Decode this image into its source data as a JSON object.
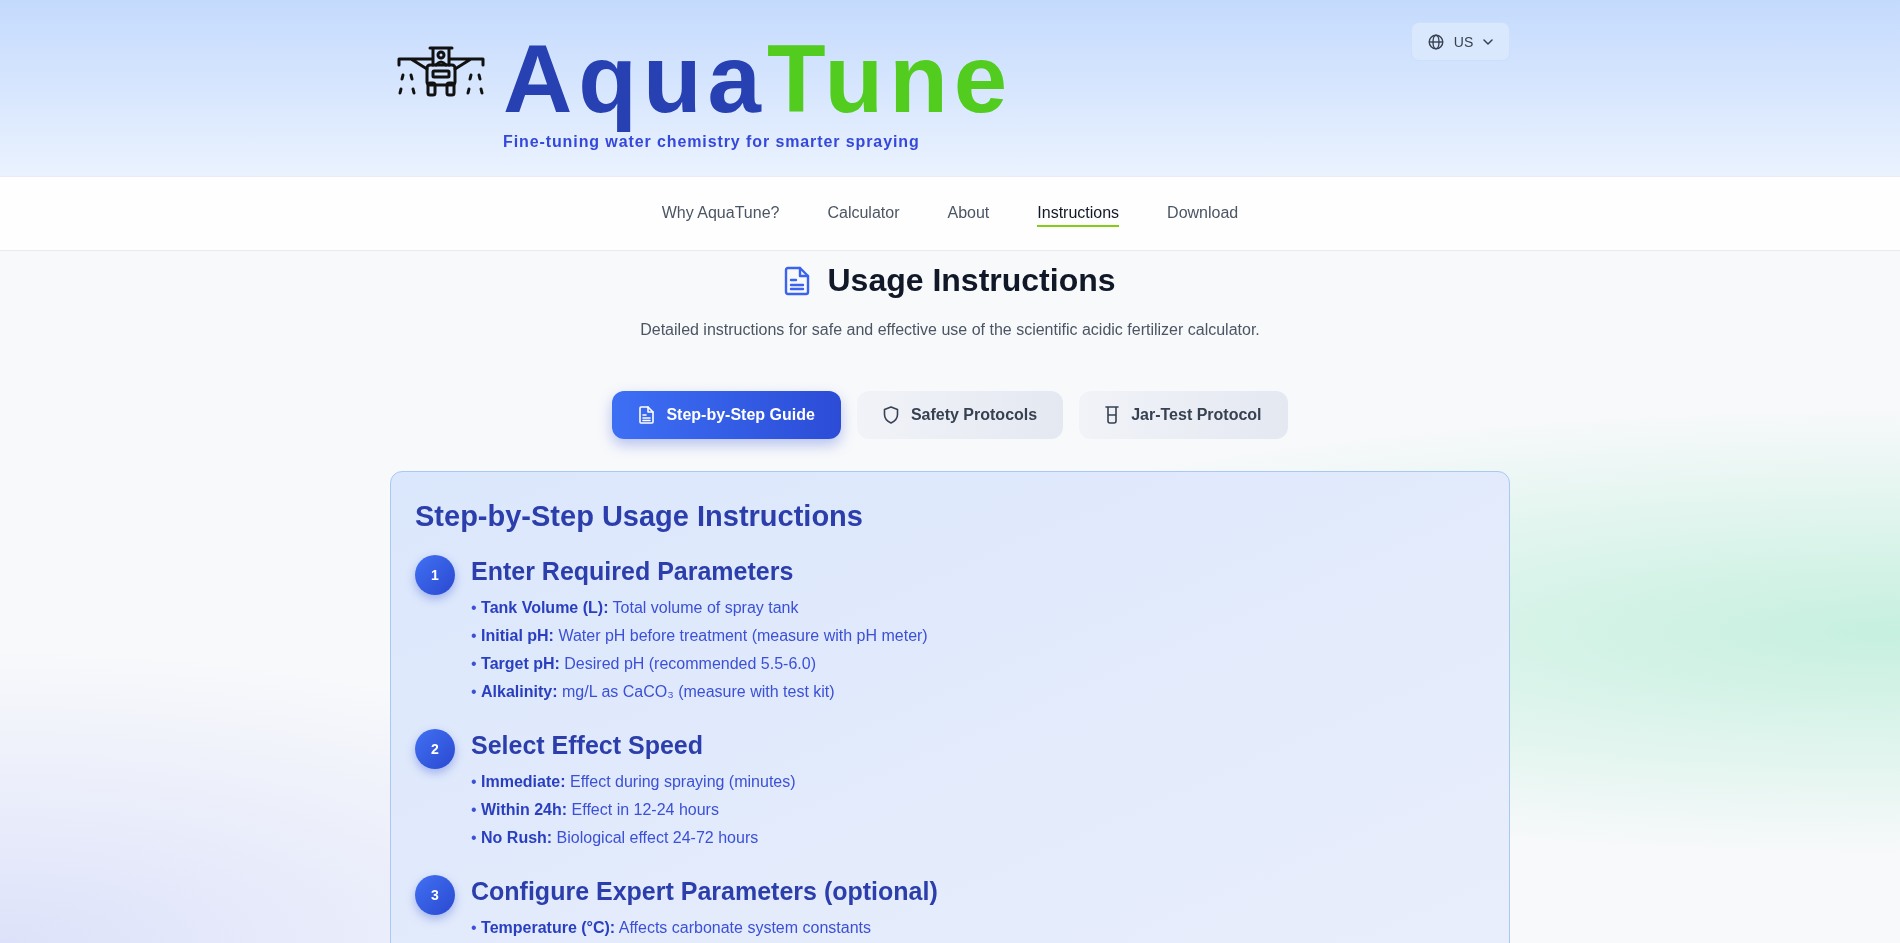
{
  "header": {
    "logo": {
      "part_1": "Aqua",
      "part_2": "Tune"
    },
    "tagline": "Fine-tuning water chemistry for smarter spraying",
    "language_button": {
      "label": "US"
    }
  },
  "nav": [
    {
      "label": "Why AquaTune?",
      "selected": false
    },
    {
      "label": "Calculator",
      "selected": false
    },
    {
      "label": "About",
      "selected": false
    },
    {
      "label": "Instructions",
      "selected": true
    },
    {
      "label": "Download",
      "selected": false
    }
  ],
  "page": {
    "title": "Usage Instructions",
    "subtitle": "Detailed instructions for safe and effective use of the scientific acidic fertilizer calculator."
  },
  "tabs": [
    {
      "label": "Step-by-Step Guide",
      "selected": true
    },
    {
      "label": "Safety Protocols",
      "selected": false
    },
    {
      "label": "Jar-Test Protocol",
      "selected": false
    }
  ],
  "panel": {
    "title": "Step-by-Step Usage Instructions",
    "steps": [
      {
        "number": "1",
        "title": "Enter Required Parameters",
        "items": [
          "• **Tank Volume (L):** Total volume of spray tank",
          "• **Initial pH:** Water pH before treatment (measure with pH meter)",
          "• **Target pH:** Desired pH (recommended 5.5-6.0)",
          "• **Alkalinity:** mg/L as CaCO₃ (measure with test kit)"
        ]
      },
      {
        "number": "2",
        "title": "Select Effect Speed",
        "items": [
          "• **Immediate:** Effect during spraying (minutes)",
          "• **Within 24h:** Effect in 12-24 hours",
          "• **No Rush:** Biological effect 24-72 hours"
        ]
      },
      {
        "number": "3",
        "title": "Configure Expert Parameters (optional)",
        "items": [
          "• **Temperature (°C):** Affects carbonate system constants"
        ]
      }
    ]
  }
}
